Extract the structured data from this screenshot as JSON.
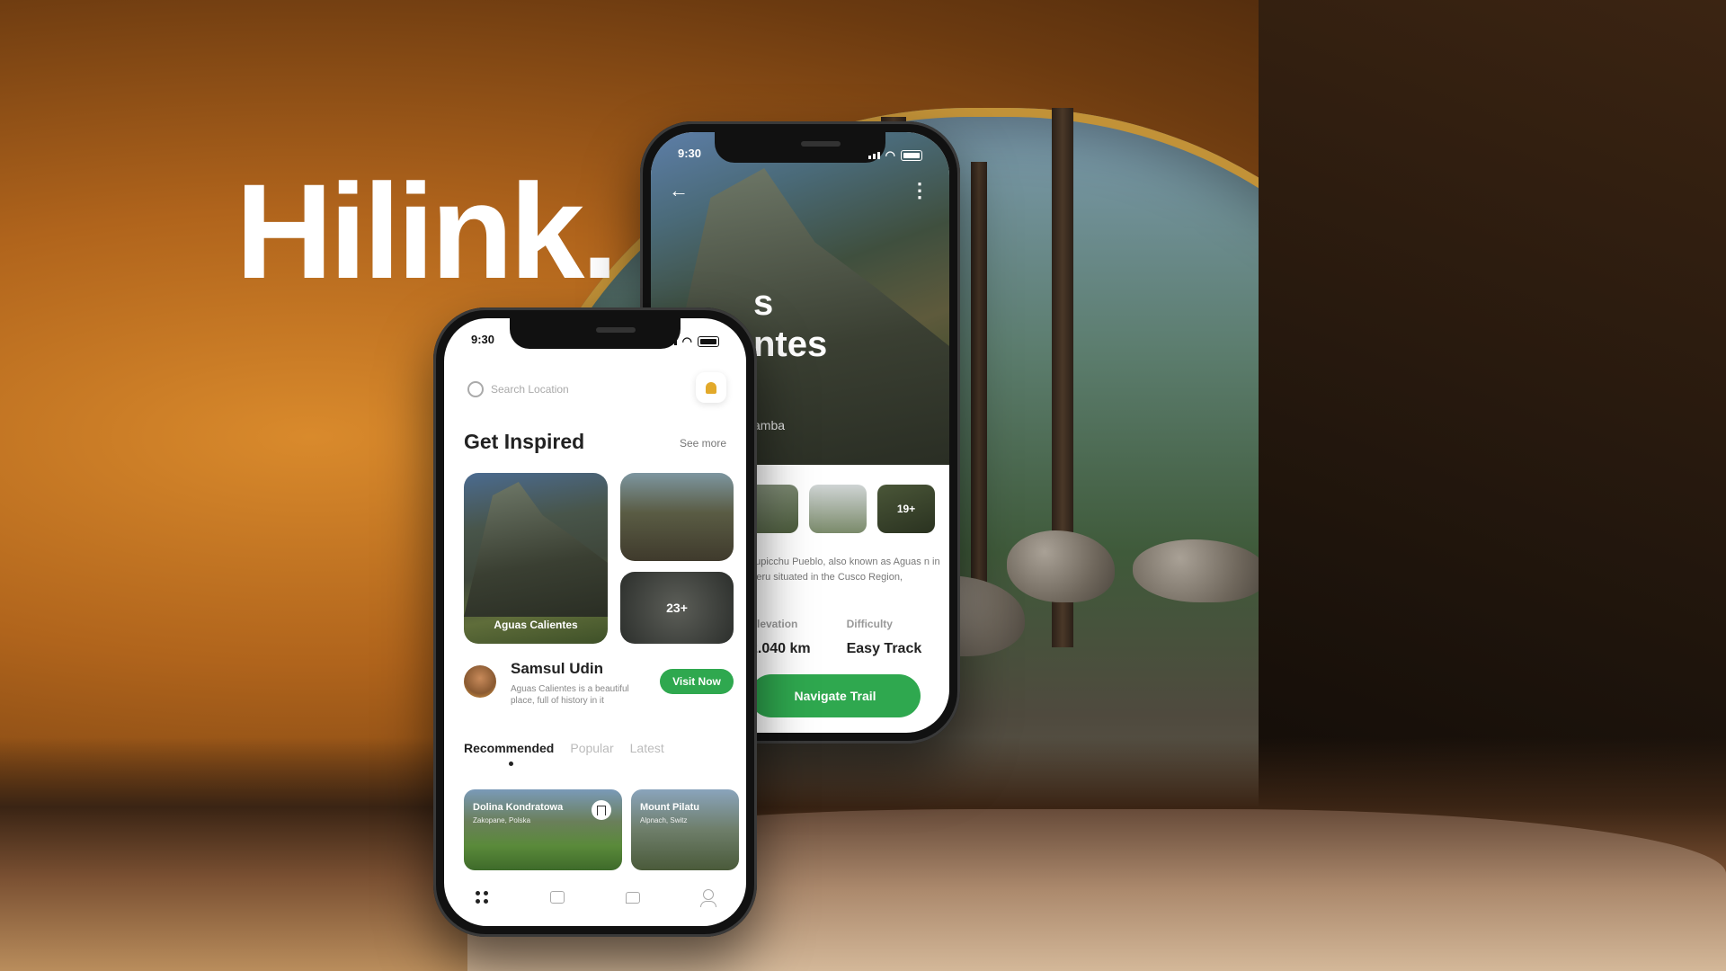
{
  "brand": {
    "title": "Hilink."
  },
  "back_phone": {
    "status_time": "9:30",
    "hero_title_line1": "s",
    "hero_title_line2": "ntes",
    "hero_subtitle": "amba",
    "thumb_more": "19+",
    "description": "hupicchu Pueblo, also known as Aguas n in Peru situated in the Cusco Region,",
    "stats": [
      {
        "label": "Elevation",
        "value": "2.040 km"
      },
      {
        "label": "Difficulty",
        "value": "Easy Track"
      }
    ],
    "cta": "Navigate Trail"
  },
  "front_phone": {
    "status_time": "9:30",
    "search_placeholder": "Search Location",
    "section_title": "Get Inspired",
    "see_more": "See more",
    "featured_card": "Aguas Calientes",
    "more_count": "23+",
    "author": {
      "name": "Samsul Udin",
      "bio": "Aguas Calientes is a beautiful place, full of history in it",
      "cta": "Visit Now"
    },
    "tabs": [
      "Recommended",
      "Popular",
      "Latest"
    ],
    "recommended": [
      {
        "title": "Dolina Kondratowa",
        "location": "Zakopane, Polska"
      },
      {
        "title": "Mount Pilatu",
        "location": "Alpnach, Switz"
      }
    ]
  },
  "colors": {
    "accent": "#2fa84f",
    "bell": "#e2a92a"
  },
  "icons": [
    "search-icon",
    "bell-icon",
    "back-arrow-icon",
    "more-icon",
    "bookmark-icon",
    "home-icon",
    "explore-icon",
    "chat-icon",
    "profile-icon"
  ]
}
